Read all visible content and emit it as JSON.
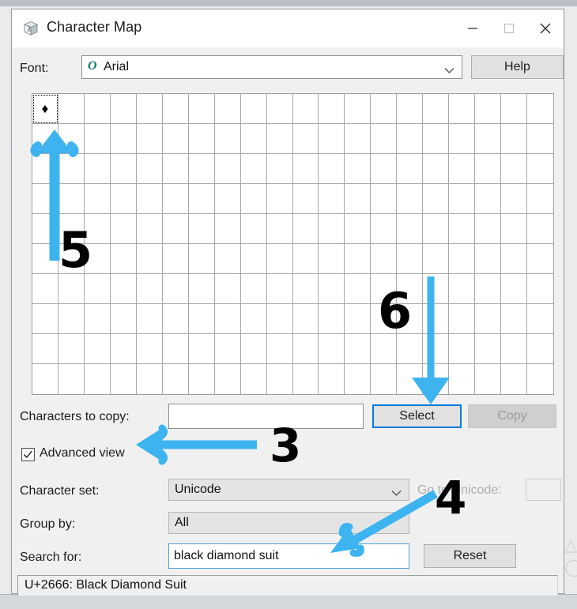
{
  "window": {
    "title": "Character Map",
    "app_icon": "character-map-cube-icon",
    "controls": {
      "minimize": "minimize-icon",
      "maximize": "maximize-icon",
      "close": "close-icon"
    }
  },
  "font_row": {
    "label": "Font:",
    "value": "Arial",
    "type_icon": "O",
    "dropdown_icon": "chevron-down-icon",
    "help_label": "Help"
  },
  "grid": {
    "columns": 20,
    "rows": 10,
    "selected_char": "♦",
    "selected_index": 0
  },
  "copy_row": {
    "label": "Characters to copy:",
    "value": "",
    "placeholder": "",
    "select_label": "Select",
    "copy_label": "Copy",
    "copy_disabled": true
  },
  "advanced": {
    "label": "Advanced view",
    "checked": true,
    "check_icon": "checkmark-icon"
  },
  "charset_row": {
    "label": "Character set:",
    "value": "Unicode",
    "dropdown_icon": "chevron-down-icon",
    "goto_label": "Go to Unicode:",
    "goto_value": "",
    "goto_disabled": true
  },
  "groupby_row": {
    "label": "Group by:",
    "value": "All"
  },
  "search_row": {
    "label": "Search for:",
    "value": "black diamond suit",
    "placeholder": "",
    "reset_label": "Reset"
  },
  "status": {
    "text": "U+2666: Black Diamond Suit"
  },
  "annotations": {
    "accent_color": "#3DB3F0",
    "items": [
      {
        "number": "5",
        "points_to": "first-grid-cell",
        "direction": "up"
      },
      {
        "number": "6",
        "points_to": "select-button",
        "direction": "down"
      },
      {
        "number": "3",
        "points_to": "advanced-view-checkbox",
        "direction": "left"
      },
      {
        "number": "4",
        "points_to": "search-input",
        "direction": "down-left"
      }
    ]
  },
  "backdrop": {
    "ghost_a": "△",
    "ghost_b": "◯"
  }
}
